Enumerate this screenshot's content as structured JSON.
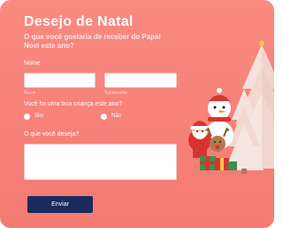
{
  "form": {
    "title": "Desejo de Natal",
    "subtitle": "O que você gostaria de receber do Papai Noel este ano?",
    "name_label": "Nome",
    "first_name_sublabel": "Nome",
    "last_name_sublabel": "Sobrenome",
    "first_name_value": "",
    "last_name_value": "",
    "good_child_question": "Você foi uma boa criança este ano?",
    "options": [
      "Sim",
      "Não"
    ],
    "wish_label": "O que você deseja?",
    "wish_value": "",
    "submit_label": "Enviar"
  },
  "colors": {
    "background": "#f5847a",
    "button": "#1b2a5e",
    "text": "#ffffff"
  },
  "illustration": {
    "icons": [
      "christmas-tree-icon",
      "snowman-icon",
      "santa-claus-icon",
      "reindeer-icon",
      "gift-box-icon"
    ]
  }
}
